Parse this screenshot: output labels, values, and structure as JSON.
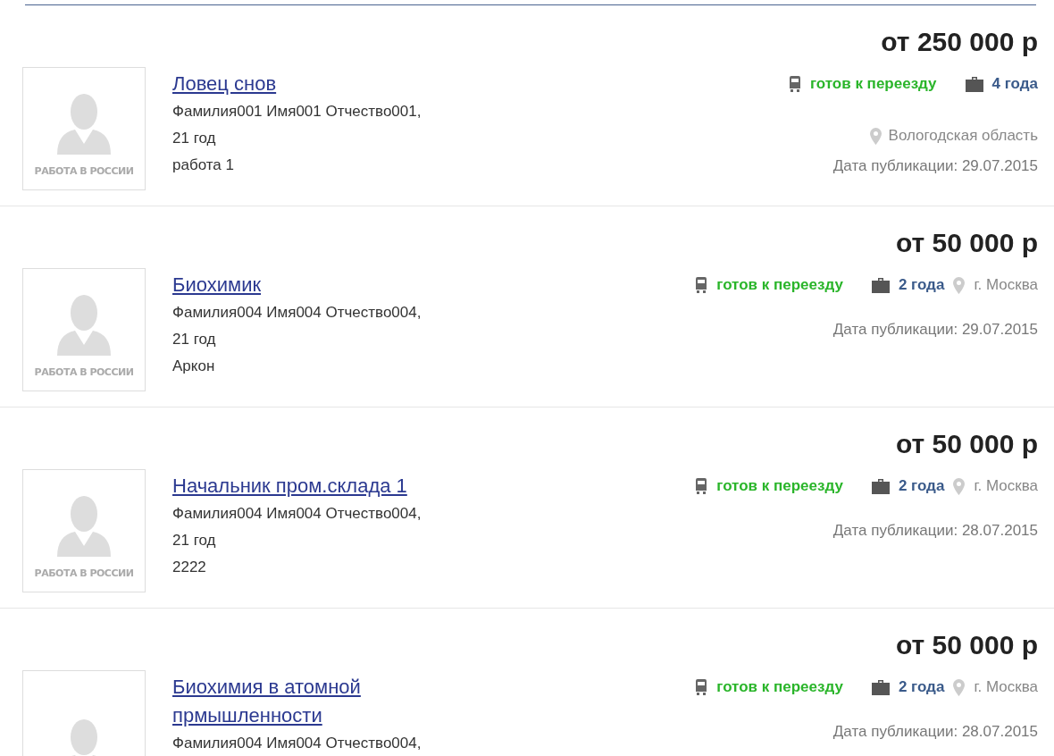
{
  "resumes": [
    {
      "salary": "от 250 000 р",
      "title": "Ловец снов",
      "person": "Фамилия001 Имя001 Отчество001,",
      "age": "21 год",
      "company": "работа 1",
      "avatar_caption": "РАБОТА В РОССИИ",
      "relocation": "готов к переезду",
      "experience": "4 года",
      "location": "Вологодская область",
      "kind": "stacked",
      "date": "Дата публикации: 29.07.2015"
    },
    {
      "salary": "от 50 000 р",
      "title": "Биохимик",
      "person": "Фамилия004 Имя004 Отчество004,",
      "age": "21 год",
      "company": "Аркон",
      "avatar_caption": "РАБОТА В РОССИИ",
      "relocation": "готов к переезду",
      "experience": "2 года",
      "location": "г. Москва",
      "kind": "inline",
      "date": "Дата публикации: 29.07.2015"
    },
    {
      "salary": "от 50 000 р",
      "title": "Начальник пром.склада 1",
      "person": "Фамилия004 Имя004 Отчество004,",
      "age": "21 год",
      "company": "2222",
      "avatar_caption": "РАБОТА В РОССИИ",
      "relocation": "готов к переезду",
      "experience": "2 года",
      "location": "г. Москва",
      "kind": "inline",
      "date": "Дата публикации: 28.07.2015"
    },
    {
      "salary": "от 50 000 р",
      "title": "Биохимия в атомной прмышленности",
      "person": "Фамилия004 Имя004 Отчество004,",
      "relocation": "готов к переезду",
      "experience": "2 года",
      "location": "г. Москва",
      "kind": "inline",
      "date": "Дата публикации: 28.07.2015"
    }
  ]
}
